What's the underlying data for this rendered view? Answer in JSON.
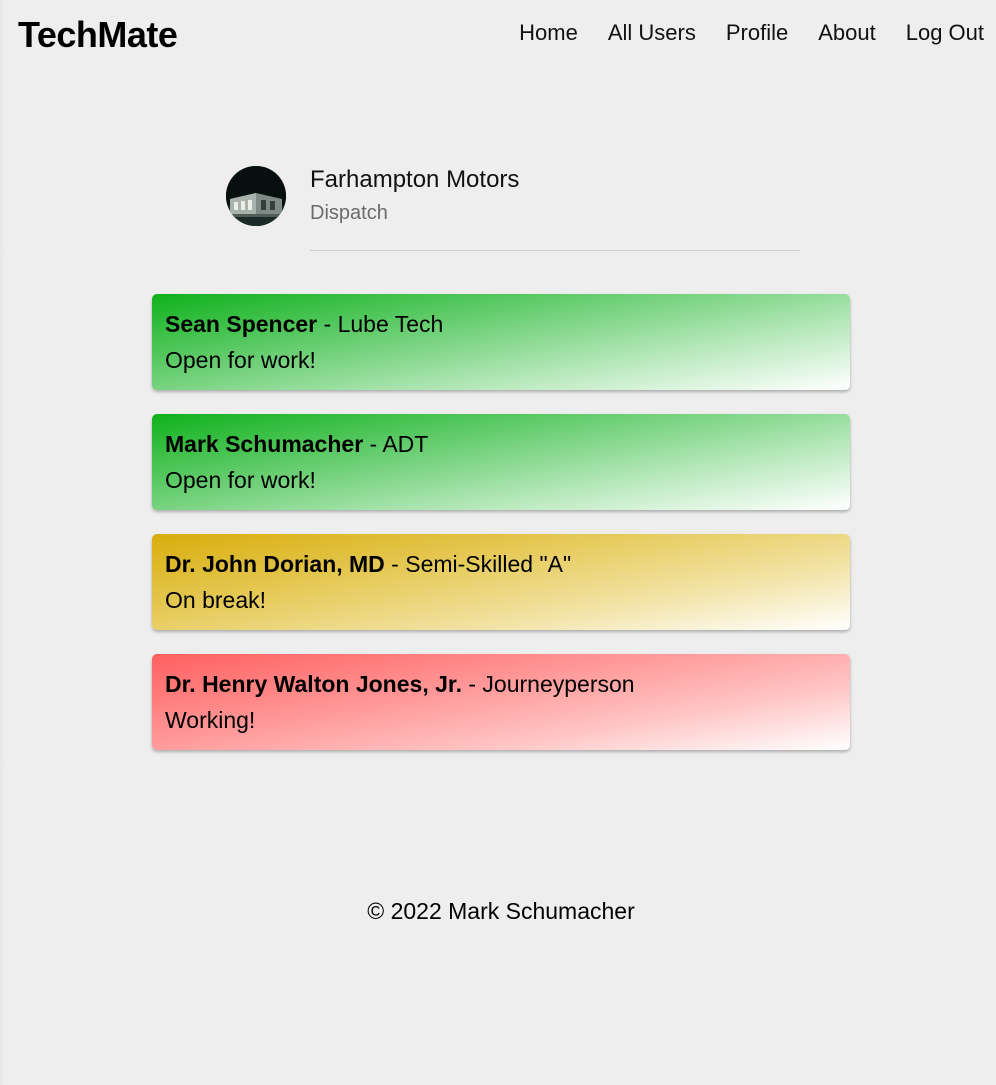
{
  "navbar": {
    "brand": "TechMate",
    "links": [
      {
        "label": "Home"
      },
      {
        "label": "All Users"
      },
      {
        "label": "Profile"
      },
      {
        "label": "About"
      },
      {
        "label": "Log Out"
      }
    ]
  },
  "profile": {
    "avatar_icon": "building-photo-avatar",
    "name": "Farhampton Motors",
    "role": "Dispatch"
  },
  "users": [
    {
      "name": "Sean Spencer",
      "separator": " - ",
      "title": "Lube Tech",
      "status": "Open for work!",
      "status_color": "green"
    },
    {
      "name": "Mark Schumacher",
      "separator": " - ",
      "title": "ADT",
      "status": "Open for work!",
      "status_color": "green"
    },
    {
      "name": "Dr. John Dorian, MD",
      "separator": " - ",
      "title": "Semi-Skilled \"A\"",
      "status": "On break!",
      "status_color": "yellow"
    },
    {
      "name": "Dr. Henry Walton Jones, Jr.",
      "separator": " - ",
      "title": "Journeyperson",
      "status": "Working!",
      "status_color": "red"
    }
  ],
  "colors": {
    "green": "#0fb11c",
    "yellow": "#d8ad0b",
    "red": "#ff6060",
    "background": "#eeeeee"
  },
  "footer": {
    "text": "© 2022 Mark Schumacher"
  }
}
